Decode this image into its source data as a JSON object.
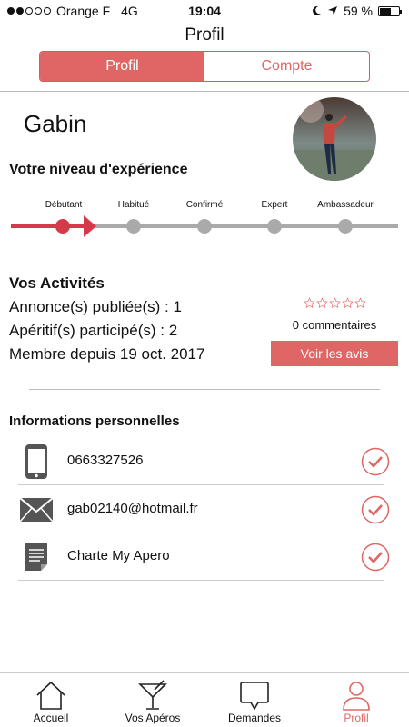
{
  "status_bar": {
    "carrier": "Orange F",
    "network": "4G",
    "time": "19:04",
    "battery": "59 %",
    "battery_level": 0.59
  },
  "header": {
    "title": "Profil"
  },
  "segments": {
    "active": "Profil",
    "inactive": "Compte"
  },
  "user": {
    "name": "Gabin"
  },
  "experience": {
    "title": "Votre niveau d'expérience",
    "levels": [
      "Débutant",
      "Habitué",
      "Confirmé",
      "Expert",
      "Ambassadeur"
    ],
    "current_index": 0
  },
  "activities": {
    "title": "Vos Activités",
    "annonces": "Annonce(s) publiée(s) : 1",
    "aperitifs": "Apéritif(s) participé(s) : 2",
    "membre": "Membre depuis 19 oct. 2017",
    "rating": 0,
    "rating_max": 5,
    "comments": "0 commentaires",
    "voir_avis": "Voir les avis"
  },
  "personal_info": {
    "title": "Informations personnelles",
    "phone": "0663327526",
    "email": "gab02140@hotmail.fr",
    "charte": "Charte My Apero"
  },
  "tabs": [
    {
      "label": "Accueil",
      "icon": "house-icon"
    },
    {
      "label": "Vos Apéros",
      "icon": "cocktail-icon"
    },
    {
      "label": "Demandes",
      "icon": "speech-bubble-icon"
    },
    {
      "label": "Profil",
      "icon": "person-icon"
    }
  ],
  "colors": {
    "accent": "#e06666",
    "accent_dark": "#d63a4a",
    "inactive": "#aaaaaa"
  }
}
